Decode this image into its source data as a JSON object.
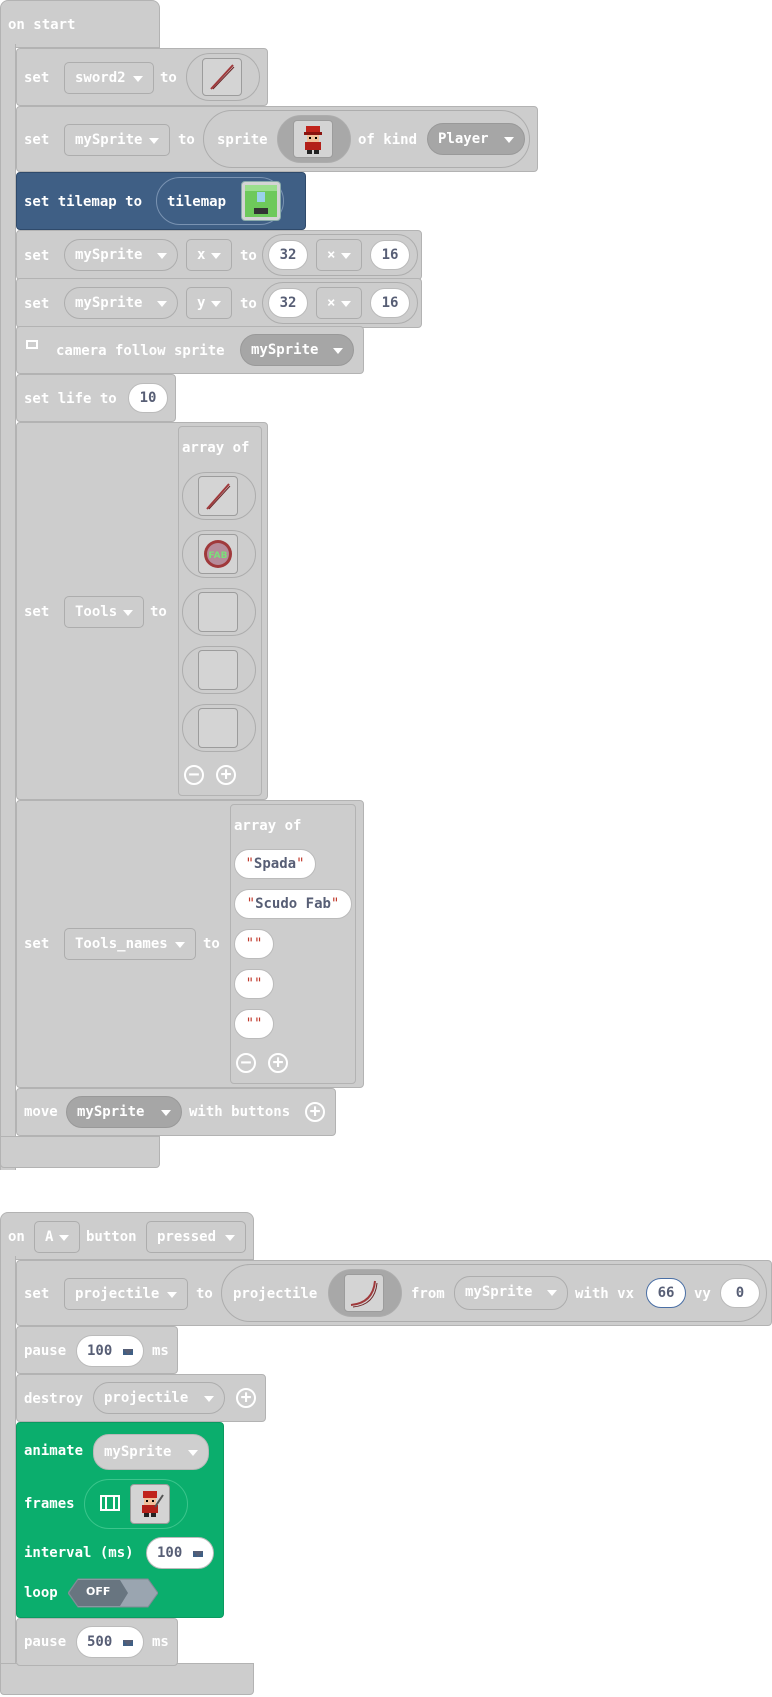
{
  "onstart": {
    "hat": "on start",
    "sword": {
      "set": "set",
      "var": "sword2",
      "to": "to"
    },
    "mysprite": {
      "set": "set",
      "var": "mySprite",
      "to": "to",
      "sprite": "sprite",
      "ofkind": "of kind",
      "kind": "Player"
    },
    "tilemap": {
      "label": "set tilemap to",
      "tilemap": "tilemap"
    },
    "setx": {
      "set": "set",
      "var": "mySprite",
      "prop": "x",
      "to": "to",
      "a": "32",
      "op": "×",
      "b": "16"
    },
    "sety": {
      "set": "set",
      "var": "mySprite",
      "prop": "y",
      "to": "to",
      "a": "32",
      "op": "×",
      "b": "16"
    },
    "camera": {
      "label": "camera follow sprite",
      "var": "mySprite"
    },
    "life": {
      "label": "set life to",
      "value": "10"
    },
    "tools": {
      "set": "set",
      "var": "Tools",
      "to": "to",
      "arrayof": "array of"
    },
    "toolnames": {
      "set": "set",
      "var": "Tools_names",
      "to": "to",
      "arrayof": "array of",
      "items": [
        "Spada",
        "Scudo Fab",
        "",
        "",
        ""
      ]
    },
    "move": {
      "label": "move",
      "var": "mySprite",
      "with": "with buttons"
    }
  },
  "onA": {
    "on": "on",
    "button": "A",
    "buttonlabel": "button",
    "event": "pressed",
    "projectile": {
      "set": "set",
      "var": "projectile",
      "to": "to",
      "projectile": "projectile",
      "from": "from",
      "sprite": "mySprite",
      "withvx": "with vx",
      "vx": "66",
      "vylabel": "vy",
      "vy": "0"
    },
    "pause1": {
      "label": "pause",
      "value": "100",
      "unit": "ms"
    },
    "destroy": {
      "label": "destroy",
      "var": "projectile"
    },
    "animate": {
      "label": "animate",
      "var": "mySprite",
      "frames": "frames",
      "interval": "interval (ms)",
      "intervalval": "100",
      "loop": "loop",
      "loopval": "OFF"
    },
    "pause2": {
      "label": "pause",
      "value": "500",
      "unit": "ms"
    }
  },
  "colors": {
    "block": "#cdcdcd",
    "tilemap": "#3f5f85",
    "animation": "#0bae6d",
    "field_text": "#575e75"
  },
  "icons": [
    "sword-icon",
    "player-sprite-icon",
    "tilemap-icon",
    "shield-icon",
    "camera-icon",
    "film-icon",
    "minus-icon",
    "plus-icon",
    "dropdown-arrow-icon"
  ]
}
